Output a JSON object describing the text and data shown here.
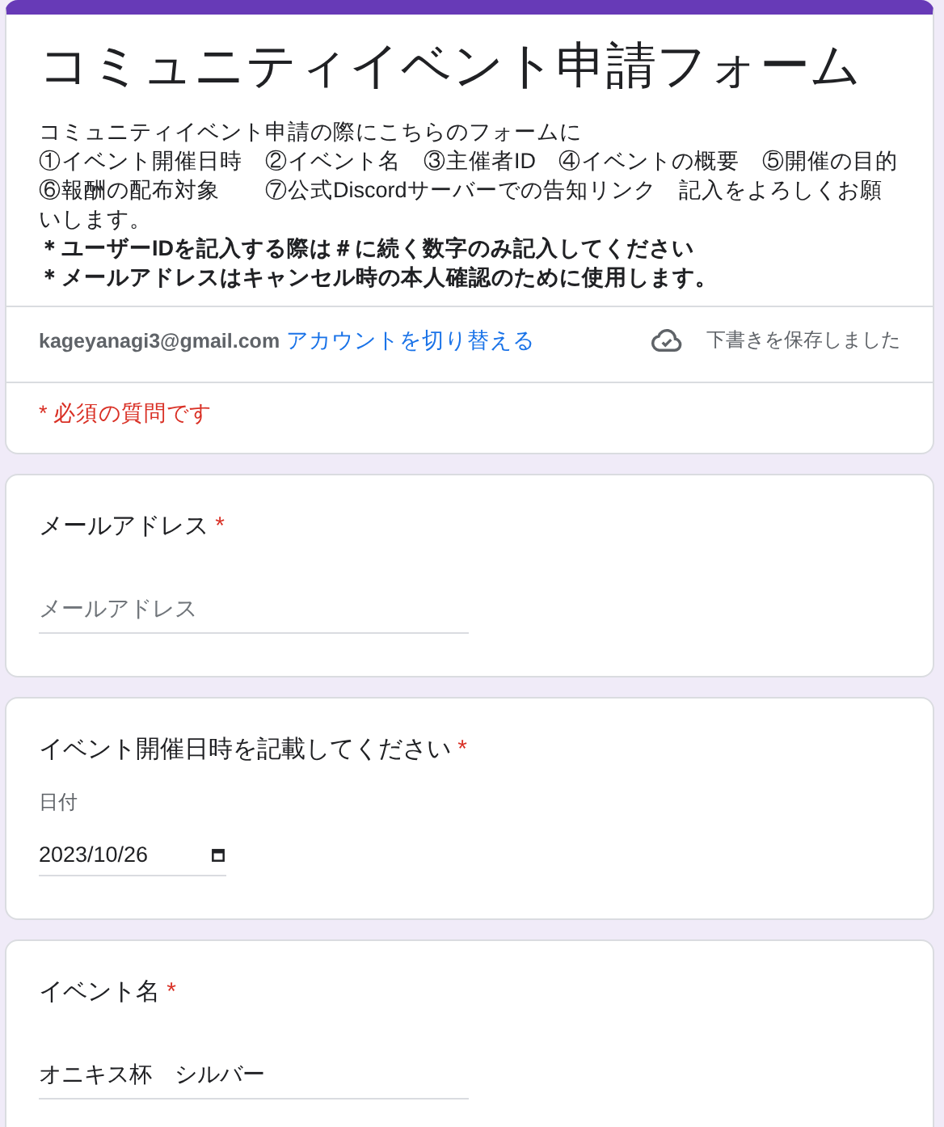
{
  "form": {
    "title": "コミュニティイベント申請フォーム",
    "description": [
      {
        "text": "コミュニティイベント申請の際にこちらのフォームに",
        "emphasis": false
      },
      {
        "text": "①イベント開催日時　②イベント名　③主催者ID　④イベントの概要　⑤開催の目的　⑥報酬の配布対象　　⑦公式Discordサーバーでの告知リンク　記入をよろしくお願いします。",
        "emphasis": false
      },
      {
        "text": "＊ユーザーIDを記入する際は＃に続く数字のみ記入してください",
        "emphasis": true
      },
      {
        "text": "＊メールアドレスはキャンセル時の本人確認のために使用します。",
        "emphasis": true
      }
    ],
    "account": {
      "email": "kageyanagi3@gmail.com",
      "switch_link": "アカウントを切り替える",
      "save_status": "下書きを保存しました"
    },
    "required_note": "* 必須の質問です"
  },
  "questions": [
    {
      "kind": "text",
      "title": "メールアドレス",
      "required_mark": "*",
      "placeholder": "メールアドレス"
    },
    {
      "kind": "date",
      "title": "イベント開催日時を記載してください",
      "required_mark": "*",
      "field_label": "日付",
      "value": "2023/10/26"
    },
    {
      "kind": "text",
      "title": "イベント名",
      "required_mark": "*",
      "value": "オニキス杯　シルバー"
    }
  ]
}
